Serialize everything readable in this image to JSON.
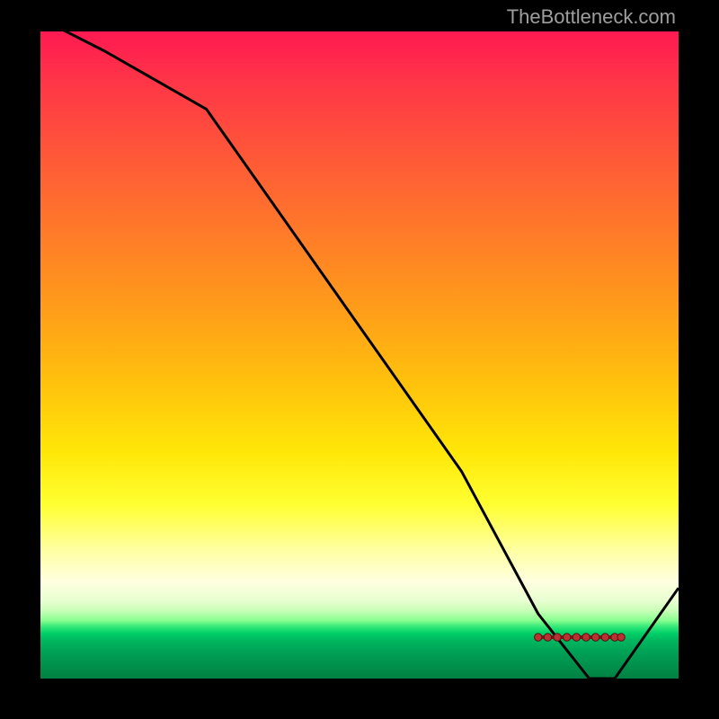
{
  "attribution": "TheBottleneck.com",
  "chart_data": {
    "type": "line",
    "title": "",
    "xlabel": "",
    "ylabel": "",
    "xlim": [
      0,
      100
    ],
    "ylim": [
      0,
      100
    ],
    "series": [
      {
        "name": "curve",
        "x": [
          0,
          10,
          26,
          46,
          66,
          78,
          86,
          88,
          90,
          100
        ],
        "values": [
          102,
          97,
          88,
          60,
          32,
          10,
          0,
          0,
          0,
          14
        ]
      }
    ],
    "markers": {
      "name": "bottom-markers",
      "x": [
        78,
        79.5,
        81,
        82.5,
        84,
        85.5,
        87,
        88.5,
        90,
        91
      ],
      "values": [
        0,
        0,
        0,
        0,
        0,
        0,
        0,
        0,
        0,
        0
      ]
    },
    "background_gradient": {
      "top": "#ff1952",
      "mid": "#ffe708",
      "bottom": "#008042"
    }
  }
}
